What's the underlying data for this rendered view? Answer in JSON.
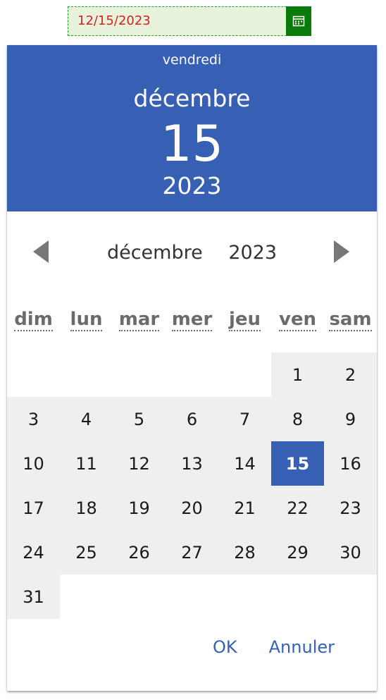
{
  "date_input": {
    "value": "12/15/2023"
  },
  "header": {
    "weekday": "vendredi",
    "month": "décembre",
    "day": "15",
    "year": "2023"
  },
  "navigation": {
    "month": "décembre",
    "year": "2023",
    "prev_icon": "triangle-left-icon",
    "next_icon": "triangle-right-icon"
  },
  "weekdays": [
    "dim",
    "lun",
    "mar",
    "mer",
    "jeu",
    "ven",
    "sam"
  ],
  "days": {
    "leading_blanks": 5,
    "count": 31,
    "selected": 15
  },
  "actions": {
    "ok_label": "OK",
    "cancel_label": "Annuler"
  },
  "colors": {
    "accent": "#3760b4",
    "input_bg": "#e8f3dc",
    "input_text": "#d62020",
    "calendar_button": "#0a7a0a",
    "day_bg": "#efefef"
  }
}
